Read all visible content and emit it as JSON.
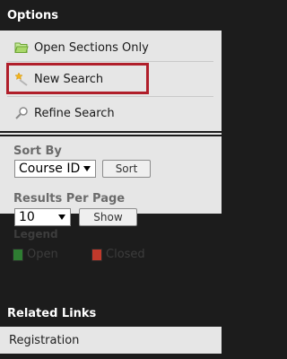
{
  "options": {
    "header": "Options",
    "items": [
      {
        "label": "Open Sections Only",
        "icon": "folder-open-icon"
      },
      {
        "label": "New Search",
        "icon": "magic-wand-icon"
      },
      {
        "label": "Refine Search",
        "icon": "magnifier-icon"
      }
    ],
    "highlight_color": "#b01e2a"
  },
  "sort": {
    "label": "Sort By",
    "selected": "Course ID",
    "button": "Sort"
  },
  "results": {
    "label": "Results Per Page",
    "selected": "10",
    "button": "Show"
  },
  "legend": {
    "title": "Legend",
    "items": [
      {
        "label": "Open",
        "color": "#2e7d32"
      },
      {
        "label": "Closed",
        "color": "#c0392b"
      }
    ]
  },
  "related": {
    "header": "Related Links",
    "items": [
      {
        "label": "Registration"
      }
    ]
  }
}
